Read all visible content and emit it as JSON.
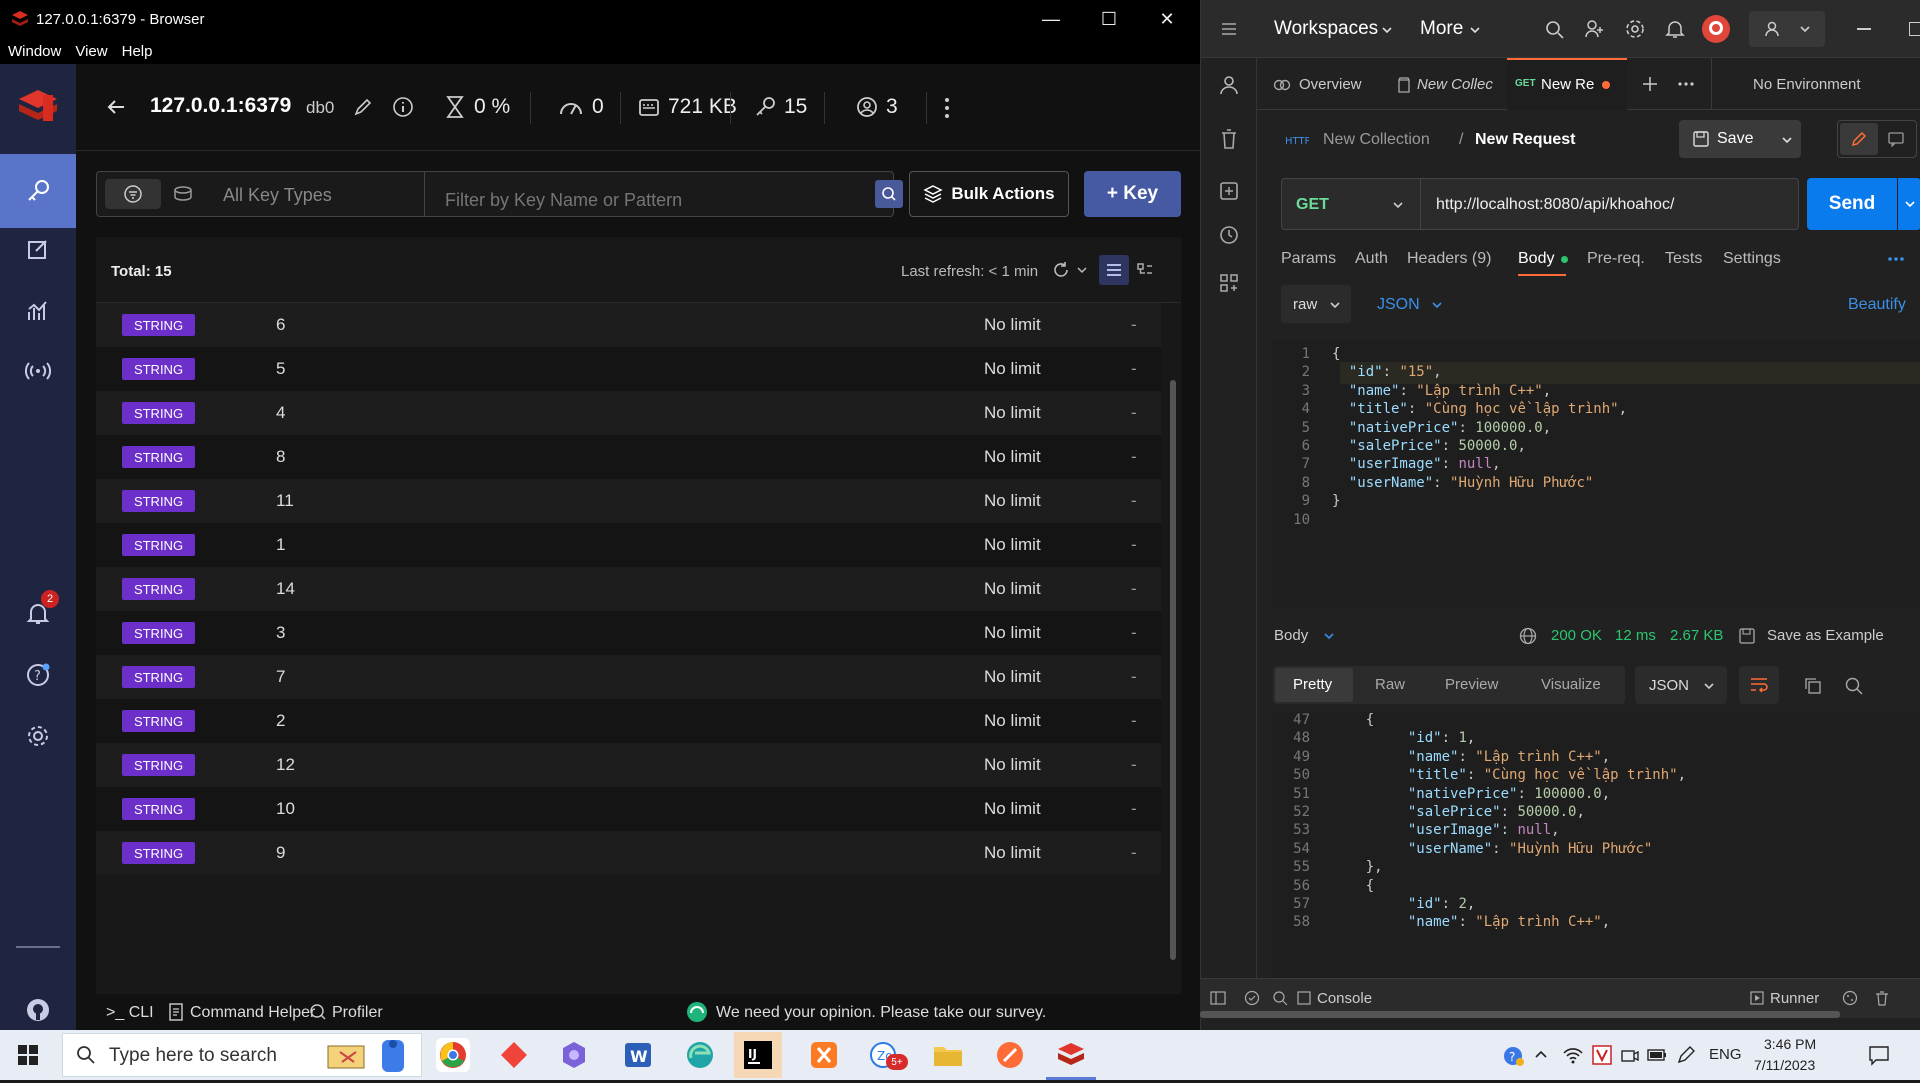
{
  "redis": {
    "window_title": "127.0.0.1:6379 - Browser",
    "menu": [
      "Window",
      "View",
      "Help"
    ],
    "host": "127.0.0.1:6379",
    "db": "db0",
    "stats": {
      "cpu": "0 %",
      "ops": "0",
      "memory": "721 KB",
      "keys": "15",
      "clients": "3"
    },
    "key_types_placeholder": "All Key Types",
    "search_placeholder": "Filter by Key Name or Pattern",
    "bulk_actions": "Bulk Actions",
    "add_key": "+ Key",
    "total": "Total: 15",
    "last_refresh": "Last refresh: < 1 min",
    "notification_count": "2",
    "rows": [
      {
        "type": "STRING",
        "key": "6",
        "ttl": "No limit",
        "size": "-"
      },
      {
        "type": "STRING",
        "key": "5",
        "ttl": "No limit",
        "size": "-"
      },
      {
        "type": "STRING",
        "key": "4",
        "ttl": "No limit",
        "size": "-"
      },
      {
        "type": "STRING",
        "key": "8",
        "ttl": "No limit",
        "size": "-"
      },
      {
        "type": "STRING",
        "key": "11",
        "ttl": "No limit",
        "size": "-"
      },
      {
        "type": "STRING",
        "key": "1",
        "ttl": "No limit",
        "size": "-"
      },
      {
        "type": "STRING",
        "key": "14",
        "ttl": "No limit",
        "size": "-"
      },
      {
        "type": "STRING",
        "key": "3",
        "ttl": "No limit",
        "size": "-"
      },
      {
        "type": "STRING",
        "key": "7",
        "ttl": "No limit",
        "size": "-"
      },
      {
        "type": "STRING",
        "key": "2",
        "ttl": "No limit",
        "size": "-"
      },
      {
        "type": "STRING",
        "key": "12",
        "ttl": "No limit",
        "size": "-"
      },
      {
        "type": "STRING",
        "key": "10",
        "ttl": "No limit",
        "size": "-"
      },
      {
        "type": "STRING",
        "key": "9",
        "ttl": "No limit",
        "size": "-"
      }
    ],
    "footer": {
      "cli": ">_ CLI",
      "helper": "Command Helper",
      "profiler": "Profiler",
      "survey": "We need your opinion. Please take our survey."
    }
  },
  "postman": {
    "top": {
      "workspaces": "Workspaces",
      "more": "More"
    },
    "tabs": {
      "overview": "Overview",
      "collection": "New Collec",
      "request_method": "GET",
      "request": "New Re",
      "env": "No Environment"
    },
    "breadcrumb": {
      "collection": "New Collection",
      "sep": "/",
      "request": "New Request"
    },
    "save": "Save",
    "method": "GET",
    "url": "http://localhost:8080/api/khoahoc/",
    "send": "Send",
    "req_tabs": {
      "params": "Params",
      "auth": "Auth",
      "headers": "Headers (9)",
      "body": "Body",
      "prereq": "Pre-req.",
      "tests": "Tests",
      "settings": "Settings"
    },
    "body_mode": "raw",
    "body_lang": "JSON",
    "beautify": "Beautify",
    "request_body": [
      {
        "ln": "1",
        "text": "{"
      },
      {
        "ln": "2",
        "key": "\"id\"",
        "val": "\"15\"",
        "vt": "s"
      },
      {
        "ln": "3",
        "key": "\"name\"",
        "val": "\"Lập trình C++\"",
        "vt": "s"
      },
      {
        "ln": "4",
        "key": "\"title\"",
        "val": "\"Cùng học về lập trình\"",
        "vt": "s"
      },
      {
        "ln": "5",
        "key": "\"nativePrice\"",
        "val": "100000.0",
        "vt": "n"
      },
      {
        "ln": "6",
        "key": "\"salePrice\"",
        "val": "50000.0",
        "vt": "n"
      },
      {
        "ln": "7",
        "key": "\"userImage\"",
        "val": "null",
        "vt": "nl"
      },
      {
        "ln": "8",
        "key": "\"userName\"",
        "val": "\"Huỳnh Hữu Phước\"",
        "vt": "s",
        "last": true
      },
      {
        "ln": "9",
        "text": "}"
      },
      {
        "ln": "10",
        "text": ""
      }
    ],
    "response": {
      "label": "Body",
      "status": "200 OK",
      "time": "12 ms",
      "size": "2.67 KB",
      "save_example": "Save as Example",
      "views": {
        "pretty": "Pretty",
        "raw": "Raw",
        "preview": "Preview",
        "visualize": "Visualize"
      },
      "format": "JSON"
    },
    "response_body": [
      {
        "ln": "47",
        "text": "    {"
      },
      {
        "ln": "48",
        "key": "\"id\"",
        "val": "1",
        "vt": "n",
        "indent": 2
      },
      {
        "ln": "49",
        "key": "\"name\"",
        "val": "\"Lập trình C++\"",
        "vt": "s",
        "indent": 2
      },
      {
        "ln": "50",
        "key": "\"title\"",
        "val": "\"Cùng học về lập trình\"",
        "vt": "s",
        "indent": 2
      },
      {
        "ln": "51",
        "key": "\"nativePrice\"",
        "val": "100000.0",
        "vt": "n",
        "indent": 2
      },
      {
        "ln": "52",
        "key": "\"salePrice\"",
        "val": "50000.0",
        "vt": "n",
        "indent": 2
      },
      {
        "ln": "53",
        "key": "\"userImage\"",
        "val": "null",
        "vt": "nl",
        "indent": 2
      },
      {
        "ln": "54",
        "key": "\"userName\"",
        "val": "\"Huỳnh Hữu Phước\"",
        "vt": "s",
        "indent": 2,
        "last": true
      },
      {
        "ln": "55",
        "text": "    },"
      },
      {
        "ln": "56",
        "text": "    {"
      },
      {
        "ln": "57",
        "key": "\"id\"",
        "val": "2",
        "vt": "n",
        "indent": 2
      },
      {
        "ln": "58",
        "key": "\"name\"",
        "val": "\"Lập trình C++\"",
        "vt": "s",
        "indent": 2
      }
    ],
    "status_bar": {
      "console": "Console",
      "runner": "Runner"
    }
  },
  "taskbar": {
    "search_placeholder": "Type here to search",
    "lang": "ENG",
    "time": "3:46 PM",
    "date": "7/11/2023",
    "mail_badge": "5+"
  }
}
